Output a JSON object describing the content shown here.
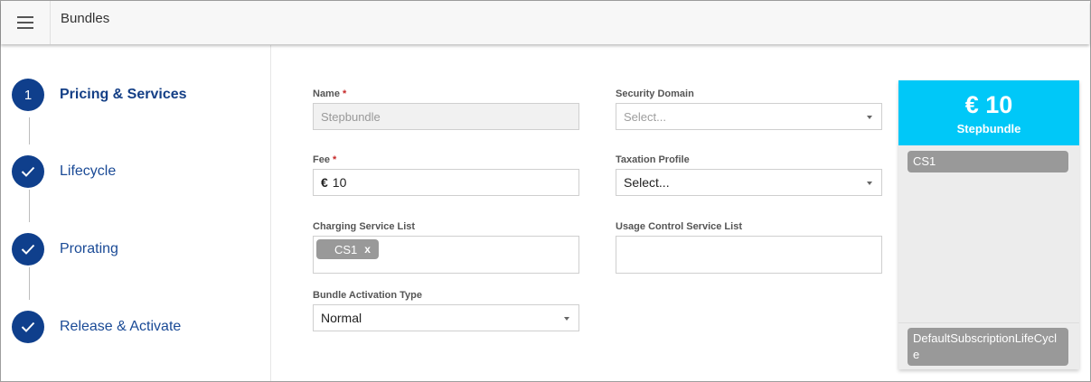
{
  "header": {
    "title": "Bundles"
  },
  "stepper": {
    "steps": [
      {
        "number": "1",
        "label": "Pricing & Services",
        "state": "active"
      },
      {
        "number": "",
        "label": "Lifecycle",
        "state": "done"
      },
      {
        "number": "",
        "label": "Prorating",
        "state": "done"
      },
      {
        "number": "",
        "label": "Release & Activate",
        "state": "done"
      }
    ]
  },
  "form": {
    "name": {
      "label": "Name",
      "required_mark": "*",
      "value": "Stepbundle"
    },
    "fee": {
      "label": "Fee",
      "required_mark": "*",
      "currency": "€",
      "value": "10"
    },
    "charging_service_list": {
      "label": "Charging Service List",
      "chips": [
        {
          "label": "CS1",
          "remove": "x"
        }
      ]
    },
    "bundle_activation_type": {
      "label": "Bundle Activation Type",
      "value": "Normal"
    },
    "security_domain": {
      "label": "Security Domain",
      "placeholder": "Select..."
    },
    "taxation_profile": {
      "label": "Taxation Profile",
      "value": "Select..."
    },
    "usage_control_service_list": {
      "label": "Usage Control Service List"
    }
  },
  "preview": {
    "price": "€ 10",
    "name": "Stepbundle",
    "service": "CS1",
    "lifecycle": "DefaultSubscriptionLifeCycle",
    "header_color": "#00c8f8"
  },
  "colors": {
    "step_circle": "#0f3f8c",
    "step_label": "#1a4a96",
    "chip": "#999999"
  }
}
